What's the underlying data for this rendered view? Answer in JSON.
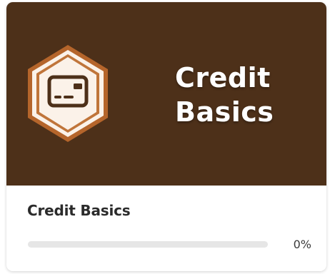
{
  "card": {
    "banner_title_line1": "Credit",
    "banner_title_line2": "Basics",
    "title": "Credit Basics",
    "progress": {
      "value": 0,
      "label": "0%"
    },
    "badge_icon": "credit-card-icon"
  },
  "colors": {
    "banner_bg": "#4d3019",
    "badge_outer": "#b5652b",
    "badge_inner": "#fbf2e9",
    "icon_stroke": "#4d3019",
    "progress_track": "#e6e6e6"
  }
}
